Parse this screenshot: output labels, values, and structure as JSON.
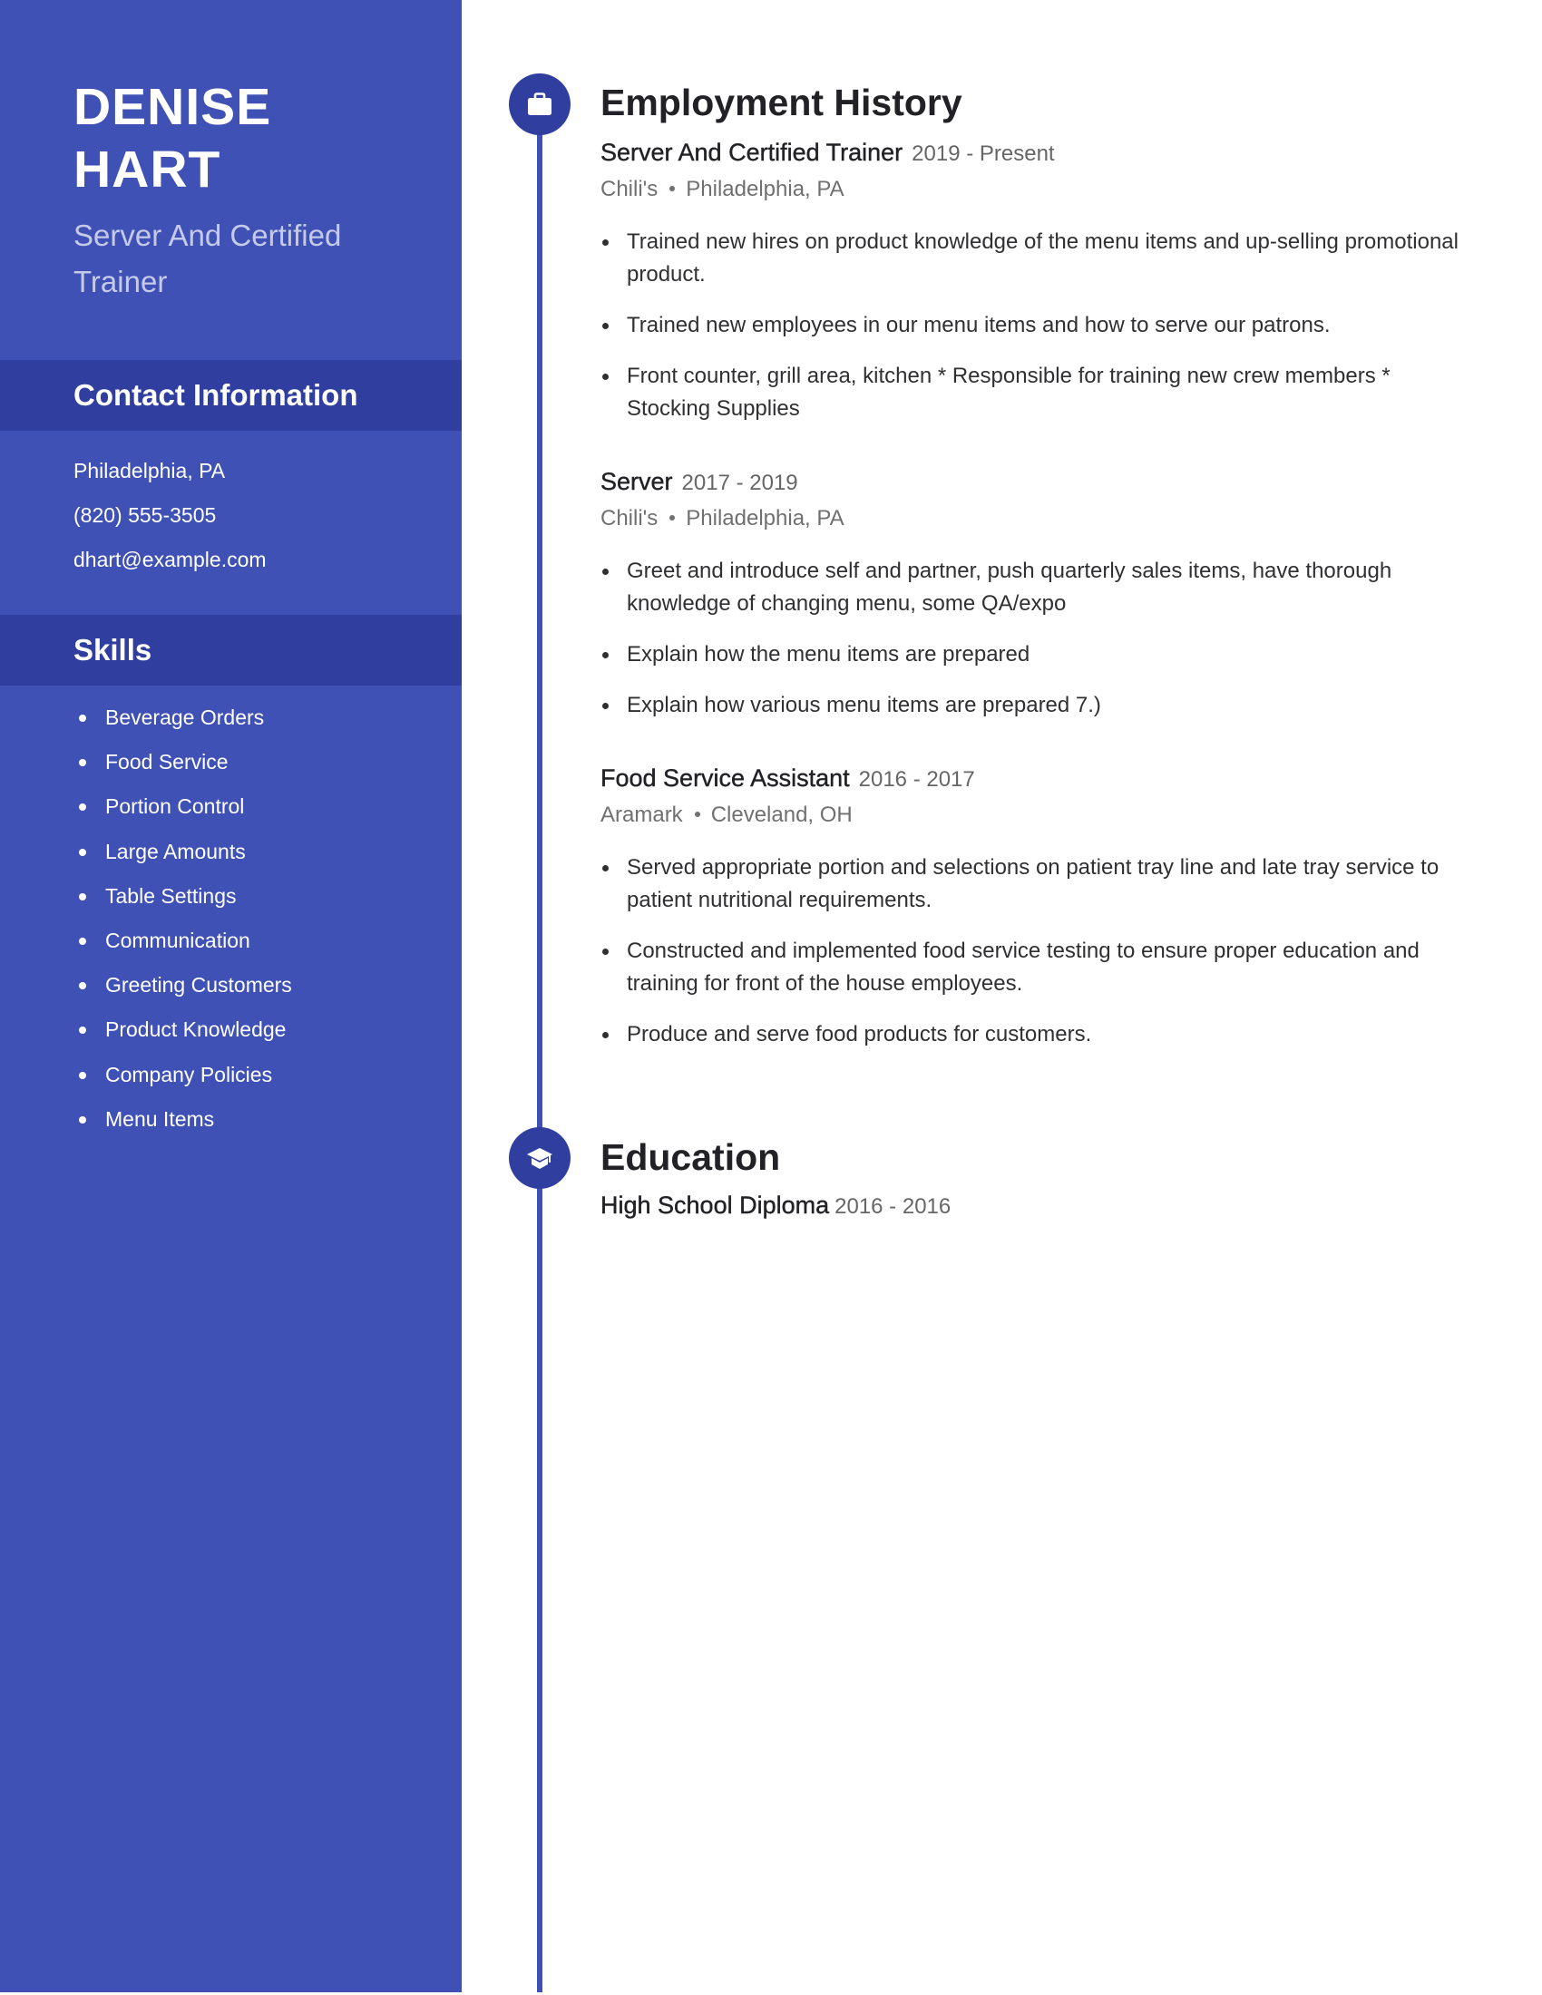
{
  "sidebar": {
    "name_line1": "DENISE",
    "name_line2": "HART",
    "subtitle": "Server And Certified Trainer",
    "contact": {
      "heading": "Contact Information",
      "location": "Philadelphia, PA",
      "phone": "(820) 555-3505",
      "email": "dhart@example.com"
    },
    "skills": {
      "heading": "Skills",
      "items": [
        "Beverage Orders",
        "Food Service",
        "Portion Control",
        "Large Amounts",
        "Table Settings",
        "Communication",
        "Greeting Customers",
        "Product Knowledge",
        "Company Policies",
        "Menu Items"
      ]
    }
  },
  "colors": {
    "sidebar_bg": "#3f51b5",
    "band_bg": "#303f9f",
    "subtitle": "#c5cae9",
    "text_dark": "#222226",
    "text_muted": "#707070"
  },
  "employment": {
    "heading": "Employment History",
    "icon": "briefcase-icon",
    "jobs": [
      {
        "title": "Server And Certified Trainer",
        "dates": "2019 - Present",
        "company": "Chili's",
        "location": "Philadelphia, PA",
        "bullets": [
          "Trained new hires on product knowledge of the menu items and up-selling promotional product.",
          "Trained new employees in our menu items and how to serve our patrons.",
          "Front counter, grill area, kitchen * Responsible for training new crew members * Stocking Supplies"
        ]
      },
      {
        "title": "Server",
        "dates": "2017 - 2019",
        "company": "Chili's",
        "location": "Philadelphia, PA",
        "bullets": [
          "Greet and introduce self and partner, push quarterly sales items, have thorough knowledge of changing menu, some QA/expo",
          "Explain how the menu items are prepared",
          "Explain how various menu items are prepared 7.)"
        ]
      },
      {
        "title": "Food Service Assistant",
        "dates": "2016 - 2017",
        "company": "Aramark",
        "location": "Cleveland, OH",
        "bullets": [
          "Served appropriate portion and selections on patient tray line and late tray service to patient nutritional requirements.",
          "Constructed and implemented food service testing to ensure proper education and training for front of the house employees.",
          "Produce and serve food products for customers."
        ]
      }
    ]
  },
  "education": {
    "heading": "Education",
    "icon": "graduation-cap-icon",
    "entries": [
      {
        "degree": "High School Diploma",
        "dates": "2016 - 2016"
      }
    ]
  }
}
